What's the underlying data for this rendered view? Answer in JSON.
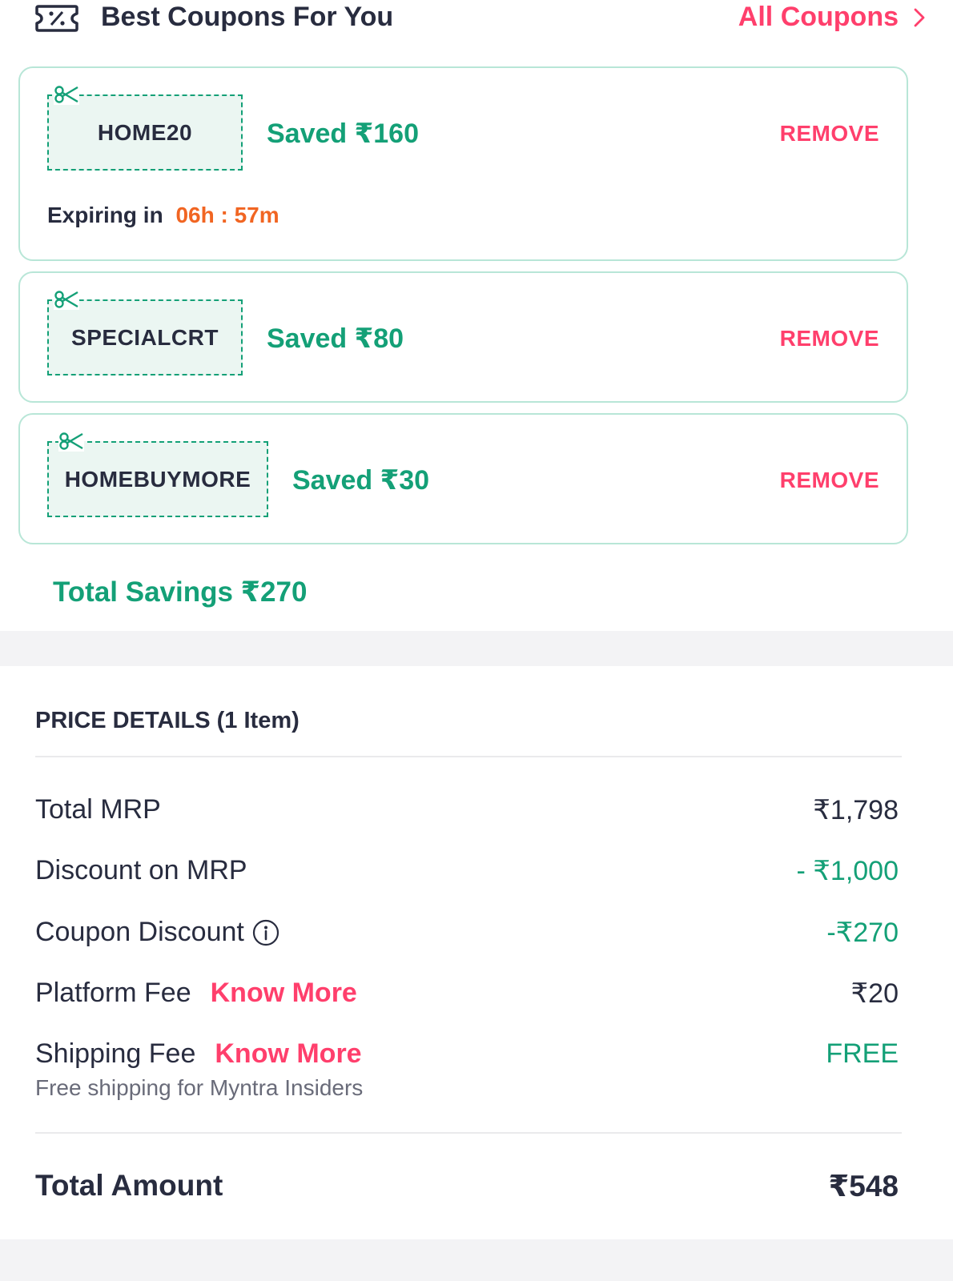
{
  "header": {
    "title": "Best Coupons For You",
    "all_coupons_label": "All Coupons"
  },
  "coupons": [
    {
      "code": "HOME20",
      "saved": "Saved ₹160",
      "remove_label": "REMOVE",
      "expiry_label": "Expiring in",
      "expiry_timer": "06h : 57m"
    },
    {
      "code": "SPECIALCRT",
      "saved": "Saved ₹80",
      "remove_label": "REMOVE"
    },
    {
      "code": "HOMEBUYMORE",
      "saved": "Saved ₹30",
      "remove_label": "REMOVE"
    }
  ],
  "total_savings": "Total Savings ₹270",
  "price_details": {
    "heading": "PRICE DETAILS (1 Item)",
    "rows": [
      {
        "label": "Total MRP",
        "value": "₹1,798"
      },
      {
        "label": "Discount on MRP",
        "value": "- ₹1,000"
      },
      {
        "label": "Coupon Discount",
        "value": "-₹270"
      },
      {
        "label": "Platform Fee",
        "link": "Know More",
        "value": "₹20"
      },
      {
        "label": "Shipping Fee",
        "link": "Know More",
        "value": "FREE",
        "note": "Free shipping for Myntra Insiders"
      }
    ],
    "total_label": "Total Amount",
    "total_value": "₹548"
  },
  "colors": {
    "accent_pink": "#ff3f6c",
    "green": "#14a077",
    "timer_orange": "#f16522",
    "text_dark": "#282c3f",
    "card_border": "#b8e6d7"
  },
  "icons": {
    "header_icon": "coupon-ticket-icon",
    "chevron": "chevron-right-icon",
    "scissor": "scissor-icon",
    "info": "info-icon"
  }
}
